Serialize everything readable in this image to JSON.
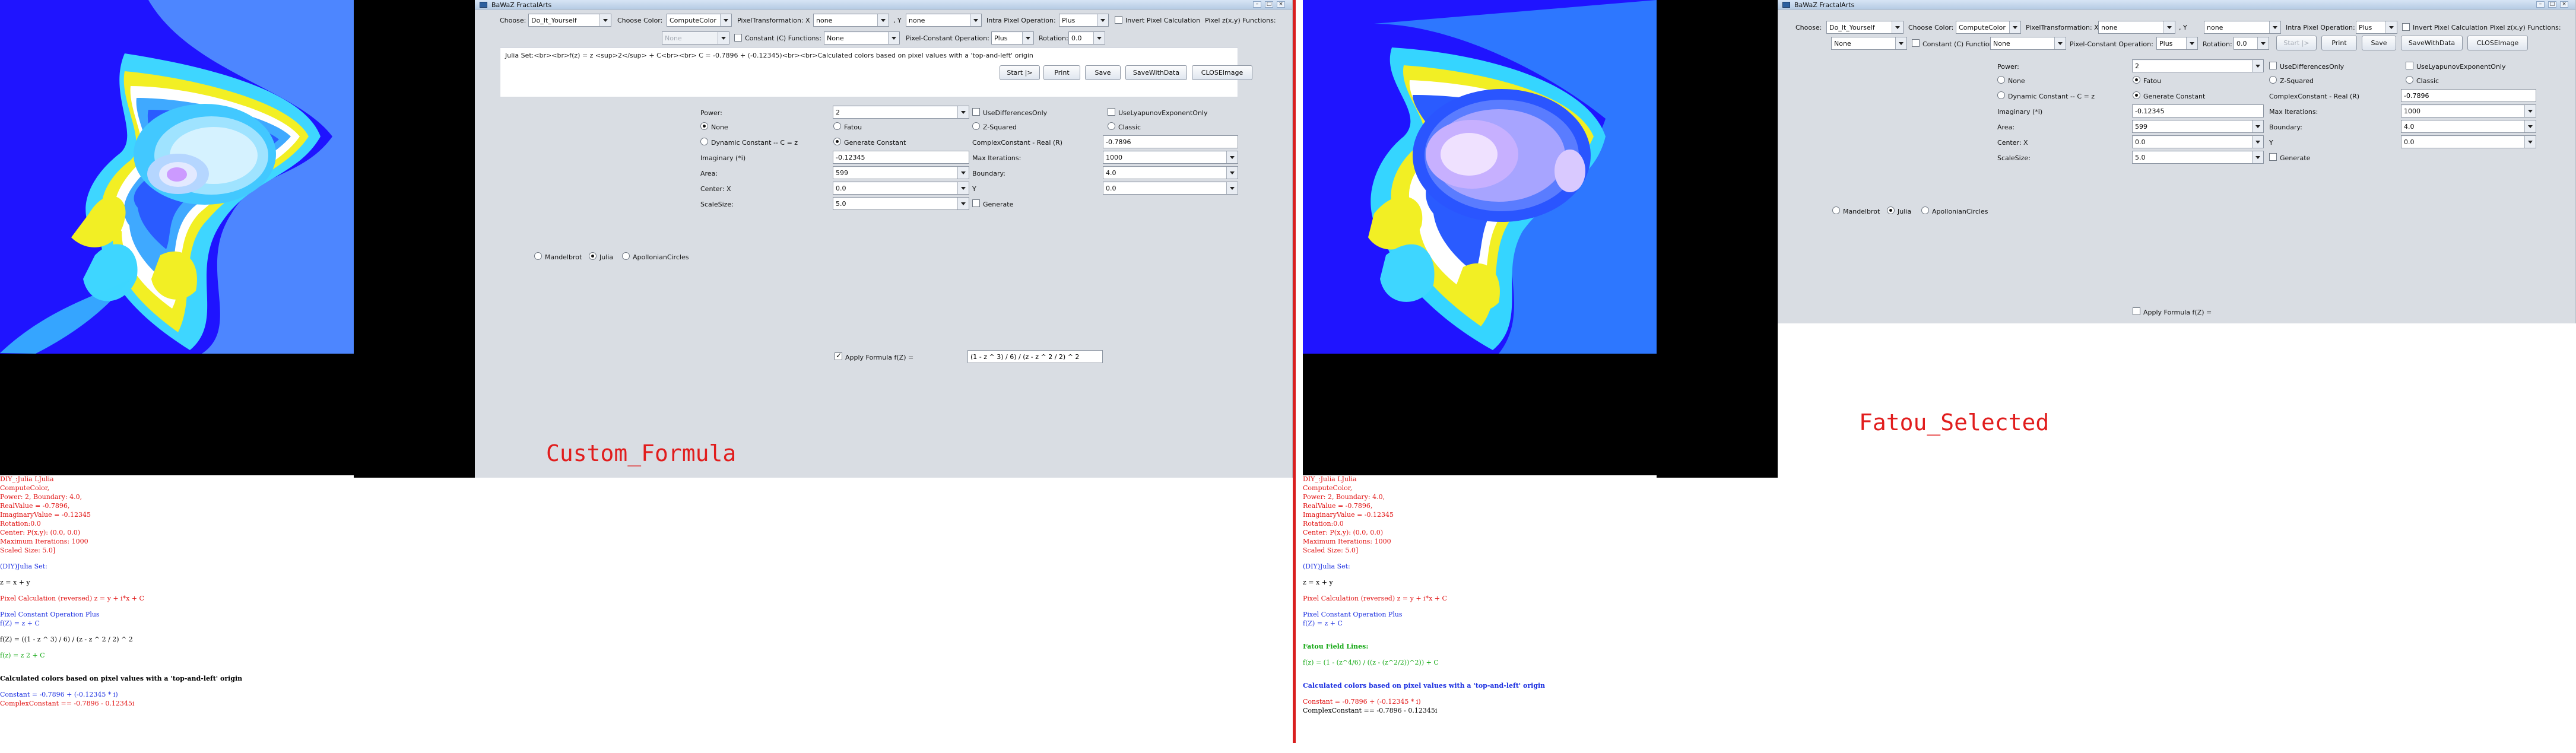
{
  "window_title": "BaWaZ FractalArts",
  "controls": {
    "choose": "Choose:",
    "choose_value": "Do_It_Yourself",
    "choose_color": "Choose Color:",
    "choose_color_value": "ComputeColor",
    "pixel_transform": "PixelTransformation: X",
    "pixel_x": "none",
    "pixel_y_label": ", Y",
    "pixel_y": "none",
    "intra": "Intra Pixel Operation:",
    "intra_value": "Plus",
    "invert": "Invert Pixel Calculation",
    "pixel_fn": "Pixel z(x,y) Functions:",
    "pixel_fn_value": "None",
    "constant_fn": "Constant (C) Functions:",
    "constant_fn_value": "None",
    "pixel_constant": "Pixel-Constant Operation:",
    "pixel_constant_value": "Plus",
    "rotation": "Rotation:",
    "rotation_value": "0.0",
    "start": "Start |>",
    "print": "Print",
    "save": "Save",
    "save_with_data": "SaveWithData",
    "close_image": "CLOSEImage",
    "power": "Power:",
    "power_value": "2",
    "use_diff": "UseDifferencesOnly",
    "use_lyapunov": "UseLyapunovExponentOnly",
    "none": "None",
    "fatou": "Fatou",
    "zsquared": "Z-Squared",
    "classic": "Classic",
    "dynamic_constant": "Dynamic Constant -- C = z",
    "generate_constant": "Generate Constant",
    "complex_constant": "ComplexConstant - Real (R)",
    "real_value": "-0.7896",
    "imaginary": "Imaginary (*i)",
    "imaginary_value": "-0.12345",
    "max_iter": "Max Iterations:",
    "max_iter_value": "1000",
    "area": "Area:",
    "area_value": "599",
    "boundary": "Boundary:",
    "boundary_value": "4.0",
    "center_x": "Center: X",
    "center_x_value": "0.0",
    "y": "Y",
    "y_value": "0.0",
    "scale_size": "ScaleSize:",
    "scale_size_value": "5.0",
    "generate": "Generate",
    "mandelbrot": "Mandelbrot",
    "julia": "Julia",
    "apollonian": "ApollonianCircles",
    "apply_formula": "Apply Formula f(Z) =",
    "formula_value": "(1 - z ^ 3) / 6) / (z - z ^ 2 / 2) ^ 2",
    "desc": "Julia Set:<br><br>f(z) = z <sup>2</sup> + C<br><br> C = -0.7896 + (-0.12345)<br><br>Calculated colors based on pixel values with a 'top-and-left' origin"
  },
  "captions": {
    "left": "Custom_Formula",
    "right": "Fatou_Selected"
  },
  "log_left": {
    "l1": "DIY_:Julia LJulia",
    "l2": "ComputeColor,",
    "l3": "Power: 2, Boundary: 4.0,",
    "l4": "RealValue = -0.7896,",
    "l5": "ImaginaryValue = -0.12345",
    "l6": "Rotation:0.0",
    "l7": "Center: P(x,y): (0.0, 0.0)",
    "l8": "Maximum Iterations: 1000",
    "l9": "Scaled Size: 5.0]",
    "l10": "(DIY)Julia Set:",
    "l11": "z = x + y",
    "l12": "Pixel Calculation (reversed) z = y + i*x + C",
    "l13": "Pixel Constant Operation Plus",
    "l14": "f(Z) = z + C",
    "l15": "f(Z) = ((1 - z ^ 3) / 6) / (z - z ^ 2 / 2) ^ 2",
    "l16": "f(z) = z 2 + C",
    "l17": "Calculated colors based on pixel values with a 'top-and-left' origin",
    "l18": "Constant = -0.7896 + (-0.12345 * i)",
    "l19": "ComplexConstant == -0.7896 - 0.12345i"
  },
  "log_right": {
    "l1": "DIY_:Julia LJulia",
    "l2": "ComputeColor,",
    "l3": "Power: 2, Boundary: 4.0,",
    "l4": "RealValue = -0.7896,",
    "l5": "ImaginaryValue = -0.12345",
    "l6": "Rotation:0.0",
    "l7": "Center: P(x,y): (0.0, 0.0)",
    "l8": "Maximum Iterations: 1000",
    "l9": "Scaled Size: 5.0]",
    "l10": "(DIY)Julia Set:",
    "l11": "z = x + y",
    "l12": "Pixel Calculation (reversed) z = y + i*x + C",
    "l13": "Pixel Constant Operation Plus",
    "l14": "f(Z) = z + C",
    "l15": "Fatou Field Lines:",
    "l16": "f(z) = (1 - (z^4/6) / ((z - (z^2/2))^2)) + C",
    "l17": "Calculated colors based on pixel values with a 'top-and-left' origin",
    "l18": "Constant = -0.7896 + (-0.12345 * i)",
    "l19": "ComplexConstant == -0.7896 - 0.12345i"
  },
  "colors": {
    "accent_red": "#e11d1d",
    "fractal_bg": "#1f14ff"
  }
}
